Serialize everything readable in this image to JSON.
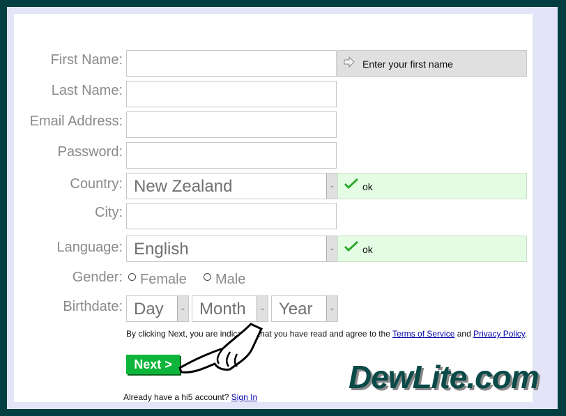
{
  "form": {
    "first_name": {
      "label": "First Name:",
      "value": "",
      "hint": "Enter your first name",
      "hint_icon": "arrow-right-icon"
    },
    "last_name": {
      "label": "Last Name:",
      "value": ""
    },
    "email": {
      "label": "Email Address:",
      "value": ""
    },
    "password": {
      "label": "Password:",
      "value": ""
    },
    "country": {
      "label": "Country:",
      "selected": "New Zealand",
      "status": "ok",
      "status_icon": "checkmark-icon"
    },
    "city": {
      "label": "City:",
      "value": ""
    },
    "language": {
      "label": "Language:",
      "selected": "English",
      "status": "ok",
      "status_icon": "checkmark-icon"
    },
    "gender": {
      "label": "Gender:",
      "options": [
        "Female",
        "Male"
      ]
    },
    "birthdate": {
      "label": "Birthdate:",
      "day": "Day",
      "month": "Month",
      "year": "Year"
    }
  },
  "terms": {
    "prefix": "By clicking Next, you are indicating that you have read and agree to the",
    "tos_link": "Terms of Service",
    "and": "and",
    "privacy_link": "Privacy Policy",
    "suffix": "."
  },
  "next_button": "Next >",
  "signin": {
    "prompt": "Already have a hi5 account?",
    "link": "Sign In"
  },
  "watermark": "DewLite.com",
  "colors": {
    "border_outer": "#033f40",
    "border_inner": "#e4e4f8",
    "next_green": "#0db63a",
    "ok_bg": "#e4fce4"
  }
}
